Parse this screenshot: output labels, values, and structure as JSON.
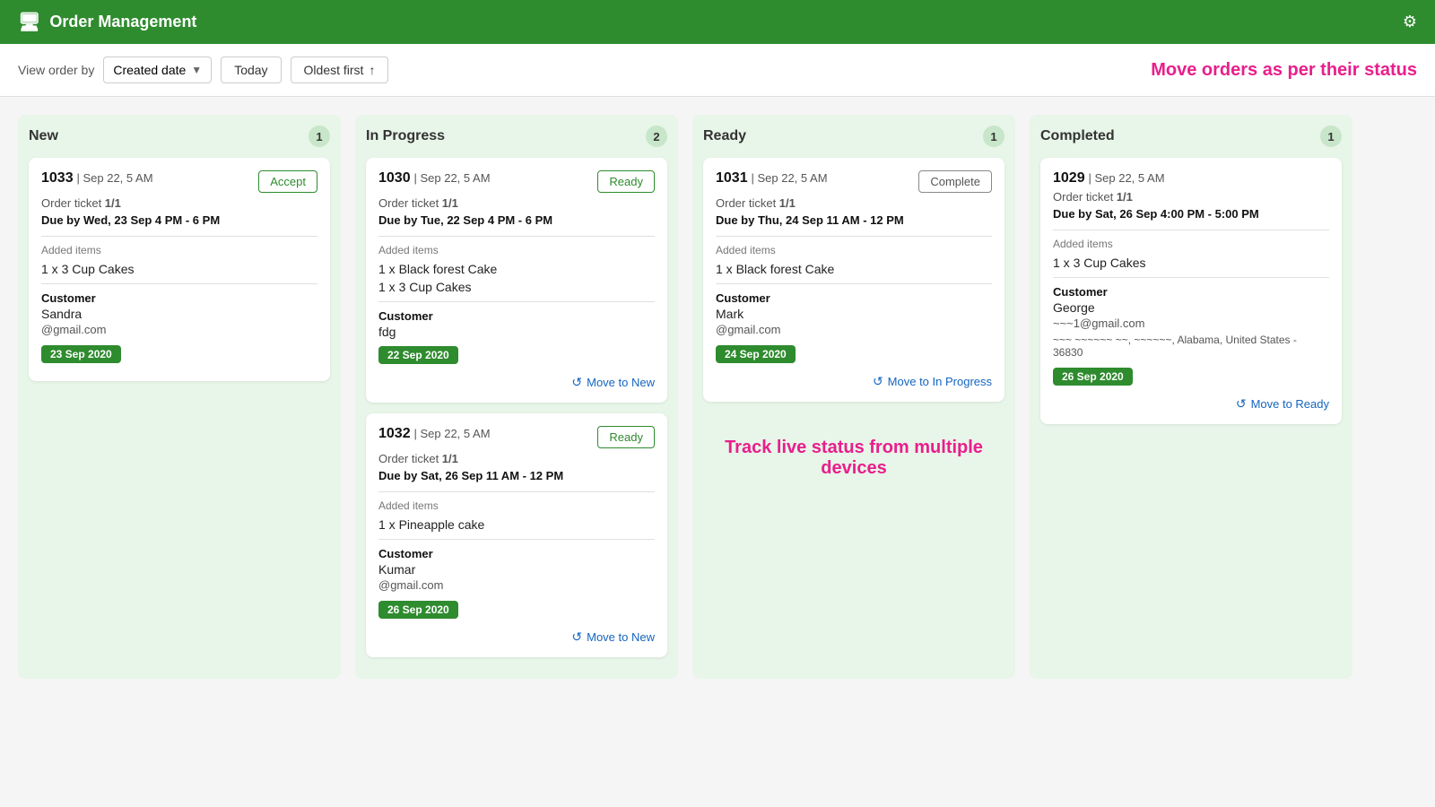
{
  "header": {
    "title": "Order Management",
    "icon": "🖥",
    "gear": "⚙"
  },
  "toolbar": {
    "view_label": "View order by",
    "sort_field": "Created date",
    "date_filter": "Today",
    "sort_order": "Oldest first",
    "sort_arrow": "↑",
    "message": "Move orders as per their status"
  },
  "columns": [
    {
      "id": "new",
      "title": "New",
      "count": "1",
      "orders": [
        {
          "id": "order-1033",
          "number": "1033",
          "date": "Sep 22, 5 AM",
          "ticket": "1/1",
          "due": "Due by Wed, 23 Sep 4 PM - 6 PM",
          "action_label": "Accept",
          "action_type": "accept",
          "items": [
            "1 x 3 Cup Cakes"
          ],
          "customer_name": "Sandra",
          "customer_email": "@gmail.com",
          "customer_address": "",
          "date_badge": "23 Sep 2020",
          "move_label": "",
          "move_arrow": ""
        }
      ]
    },
    {
      "id": "in-progress",
      "title": "In Progress",
      "count": "2",
      "orders": [
        {
          "id": "order-1030",
          "number": "1030",
          "date": "Sep 22, 5 AM",
          "ticket": "1/1",
          "due": "Due by Tue, 22 Sep 4 PM - 6 PM",
          "action_label": "Ready",
          "action_type": "ready",
          "items": [
            "1 x Black forest Cake",
            "1 x 3 Cup Cakes"
          ],
          "customer_name": "fdg",
          "customer_email": "",
          "customer_address": "",
          "date_badge": "22 Sep 2020",
          "move_label": "Move to New",
          "move_arrow": "↺"
        },
        {
          "id": "order-1032",
          "number": "1032",
          "date": "Sep 22, 5 AM",
          "ticket": "1/1",
          "due": "Due by Sat, 26 Sep 11 AM - 12 PM",
          "action_label": "Ready",
          "action_type": "ready",
          "items": [
            "1 x Pineapple cake"
          ],
          "customer_name": "Kumar",
          "customer_email": "@gmail.com",
          "customer_address": "",
          "date_badge": "26 Sep 2020",
          "move_label": "Move to New",
          "move_arrow": "↺"
        }
      ]
    },
    {
      "id": "ready",
      "title": "Ready",
      "count": "1",
      "orders": [
        {
          "id": "order-1031",
          "number": "1031",
          "date": "Sep 22, 5 AM",
          "ticket": "1/1",
          "due": "Due by Thu, 24 Sep 11 AM - 12 PM",
          "action_label": "Complete",
          "action_type": "complete",
          "items": [
            "1 x Black forest Cake"
          ],
          "customer_name": "Mark",
          "customer_email": "@gmail.com",
          "customer_address": "",
          "date_badge": "24 Sep 2020",
          "move_label": "Move to In Progress",
          "move_arrow": "↺"
        }
      ]
    },
    {
      "id": "completed",
      "title": "Completed",
      "count": "1",
      "orders": [
        {
          "id": "order-1029",
          "number": "1029",
          "date": "Sep 22, 5 AM",
          "ticket": "1/1",
          "due": "Due by Sat, 26 Sep 4:00 PM - 5:00 PM",
          "action_label": "",
          "action_type": "none",
          "items": [
            "1 x 3 Cup Cakes"
          ],
          "customer_name": "George",
          "customer_email": "~~~1@gmail.com",
          "customer_address": "~~~ ~~~~~~ ~~, ~~~~~~, Alabama, United States - 36830",
          "date_badge": "26 Sep 2020",
          "move_label": "Move to Ready",
          "move_arrow": "↺"
        }
      ]
    }
  ],
  "track_message": "Track live status from multiple devices"
}
